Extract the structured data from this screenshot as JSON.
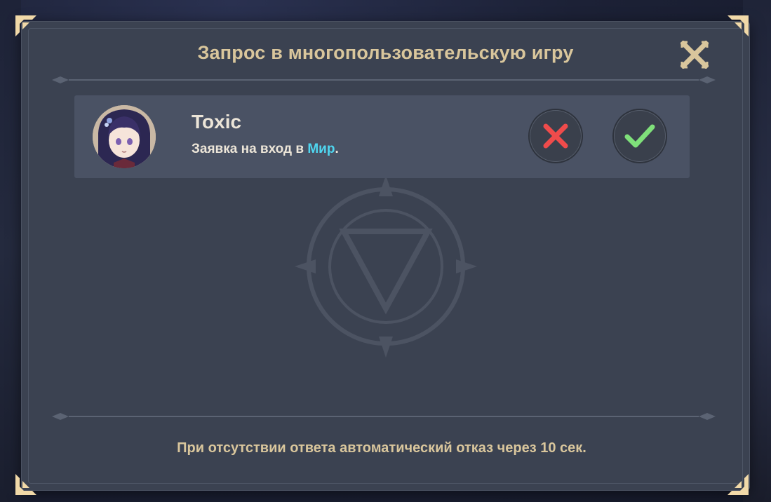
{
  "dialog": {
    "title": "Запрос в многопользовательскую игру",
    "close_icon": "close-x-icon"
  },
  "request": {
    "player_name": "Toxic",
    "message_prefix": "Заявка на вход в ",
    "world_name": "Мир",
    "message_suffix": ".",
    "decline_icon": "red-x-icon",
    "accept_icon": "green-check-icon"
  },
  "footer": {
    "text": "При отсутствии ответа автоматический отказ через 10 сек."
  },
  "colors": {
    "panel": "#3b4251",
    "row": "#4a5264",
    "title_gold": "#d9c69c",
    "world_cyan": "#4fd6f0",
    "decline_red": "#ef4b4b",
    "accept_green": "#7fe07a"
  }
}
